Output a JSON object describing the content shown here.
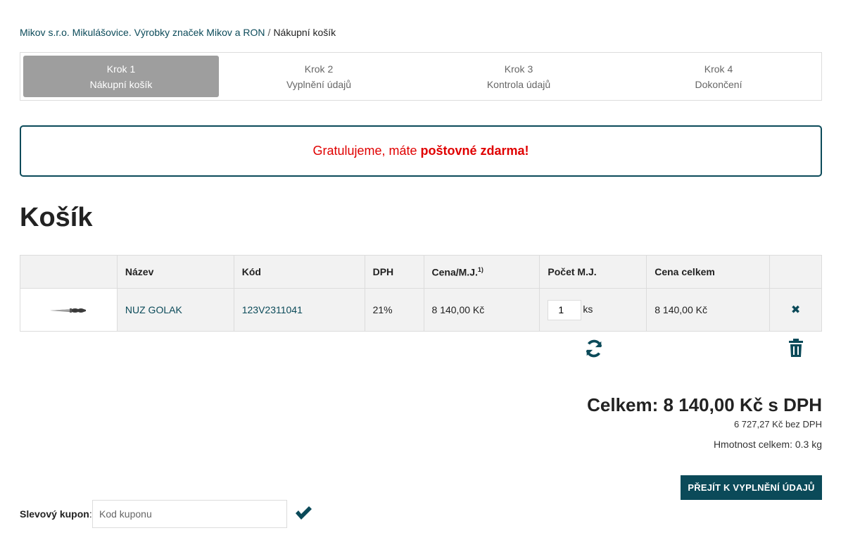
{
  "breadcrumb": {
    "home": "Mikov s.r.o. Mikulášovice. Výrobky značek Mikov a RON",
    "separator": "/",
    "current": "Nákupní košík"
  },
  "steps": [
    {
      "step": "Krok 1",
      "label": "Nákupní košík",
      "active": true
    },
    {
      "step": "Krok 2",
      "label": "Vyplnění údajů",
      "active": false
    },
    {
      "step": "Krok 3",
      "label": "Kontrola údajů",
      "active": false
    },
    {
      "step": "Krok 4",
      "label": "Dokončení",
      "active": false
    }
  ],
  "notice": {
    "text": "Gratulujeme, máte",
    "highlight": "poštovné zdarma!",
    "color": "#e00000"
  },
  "title": "Košík",
  "table": {
    "headers": {
      "name": "Název",
      "code": "Kód",
      "vat": "DPH",
      "unit_price": "Cena/M.J.",
      "unit_price_note": "1)",
      "quantity": "Počet M.J.",
      "total": "Cena celkem"
    },
    "rows": [
      {
        "image": "knife-thumbnail",
        "name": "NUZ GOLAK",
        "code": "123V2311041",
        "vat": "21%",
        "unit_price": "8 140,00 Kč",
        "quantity": "1",
        "unit": "ks",
        "total": "8 140,00 Kč",
        "remove_icon": "close-icon"
      }
    ]
  },
  "actions": {
    "refresh_icon": "refresh-icon",
    "trash_icon": "trash-icon"
  },
  "summary": {
    "total": "Celkem: 8 140,00 Kč s DPH",
    "without_vat": "6 727,27 Kč bez DPH",
    "weight": "Hmotnost celkem: 0.3 kg"
  },
  "next_button": "PŘEJÍT K VYPLNĚNÍ ÚDAJŮ",
  "coupon": {
    "label": "Slevový kupon",
    "colon": ":",
    "placeholder": "Kod kuponu",
    "submit_icon": "check-icon"
  },
  "colors": {
    "accent": "#0b4a59",
    "step_active": "#9e9e9e",
    "notice_text": "#e00000"
  }
}
